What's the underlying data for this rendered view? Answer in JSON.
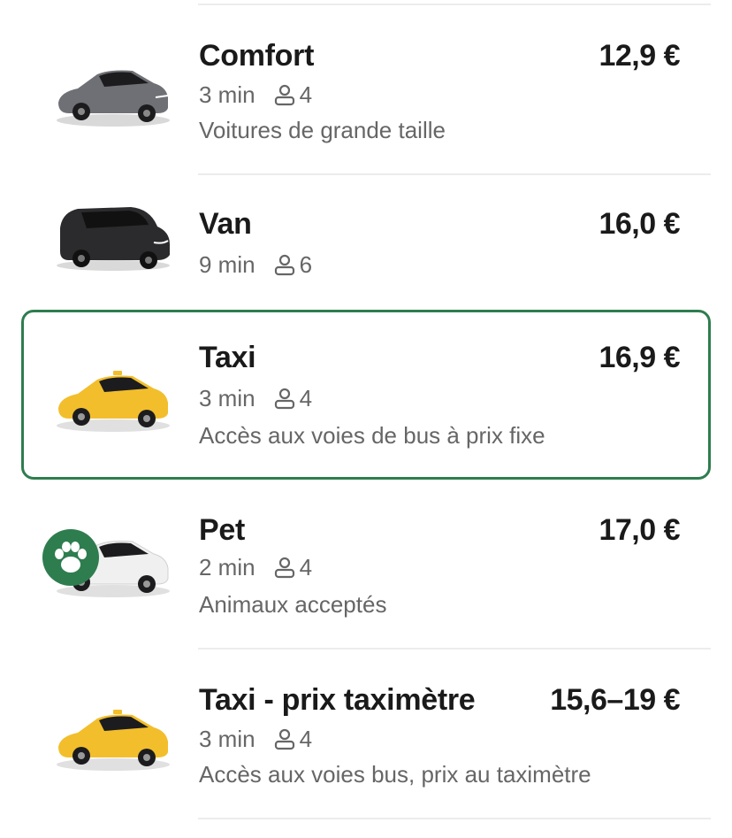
{
  "rides": [
    {
      "name": "Comfort",
      "price": "12,9 €",
      "eta": "3 min",
      "seats": "4",
      "description": "Voitures de grande taille",
      "car_color": "#6e7075",
      "car_icon": "sedan-grey"
    },
    {
      "name": "Van",
      "price": "16,0 €",
      "eta": "9 min",
      "seats": "6",
      "description": "",
      "car_color": "#2b2b2d",
      "car_icon": "van-black"
    },
    {
      "name": "Taxi",
      "price": "16,9 €",
      "eta": "3 min",
      "seats": "4",
      "description": "Accès aux voies de bus à prix fixe",
      "car_color": "#f2be2c",
      "car_icon": "taxi-yellow",
      "selected": true
    },
    {
      "name": "Pet",
      "price": "17,0 €",
      "eta": "2 min",
      "seats": "4",
      "description": "Animaux acceptés",
      "car_color": "#f0f0f0",
      "car_icon": "sedan-white",
      "badge": "paw-icon"
    },
    {
      "name": "Taxi - prix taximètre",
      "price": "15,6–19 €",
      "eta": "3 min",
      "seats": "4",
      "description": "Accès aux voies bus, prix au taximètre",
      "car_color": "#f2be2c",
      "car_icon": "taxi-yellow"
    }
  ],
  "colors": {
    "selected_border": "#2e7d4f",
    "secondary_text": "#666666",
    "divider": "#ececec"
  }
}
